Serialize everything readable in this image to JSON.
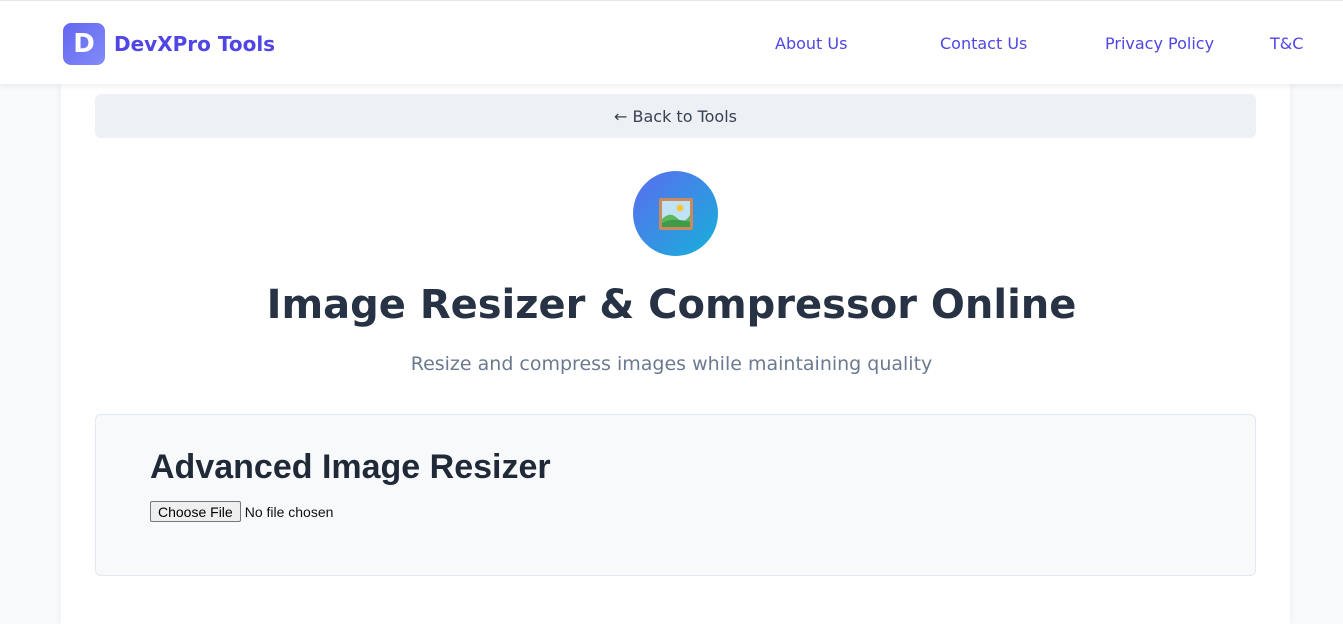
{
  "header": {
    "logo_letter": "D",
    "brand": "DevXPro Tools",
    "nav": [
      {
        "label": "About Us"
      },
      {
        "label": "Contact Us"
      },
      {
        "label": "Privacy Policy"
      },
      {
        "label": "T&C"
      }
    ]
  },
  "back_link": "← Back to Tools",
  "tool": {
    "icon": "framed-picture-icon",
    "title": "Image Resizer & Compressor Online",
    "subtitle": "Resize and compress images while maintaining quality"
  },
  "panel": {
    "heading": "Advanced Image Resizer",
    "file_button": "Choose File",
    "file_status": "No file chosen"
  },
  "colors": {
    "accent": "#4f46e5",
    "icon_gradient_start": "#5b6cf0",
    "icon_gradient_end": "#16b1d9"
  }
}
